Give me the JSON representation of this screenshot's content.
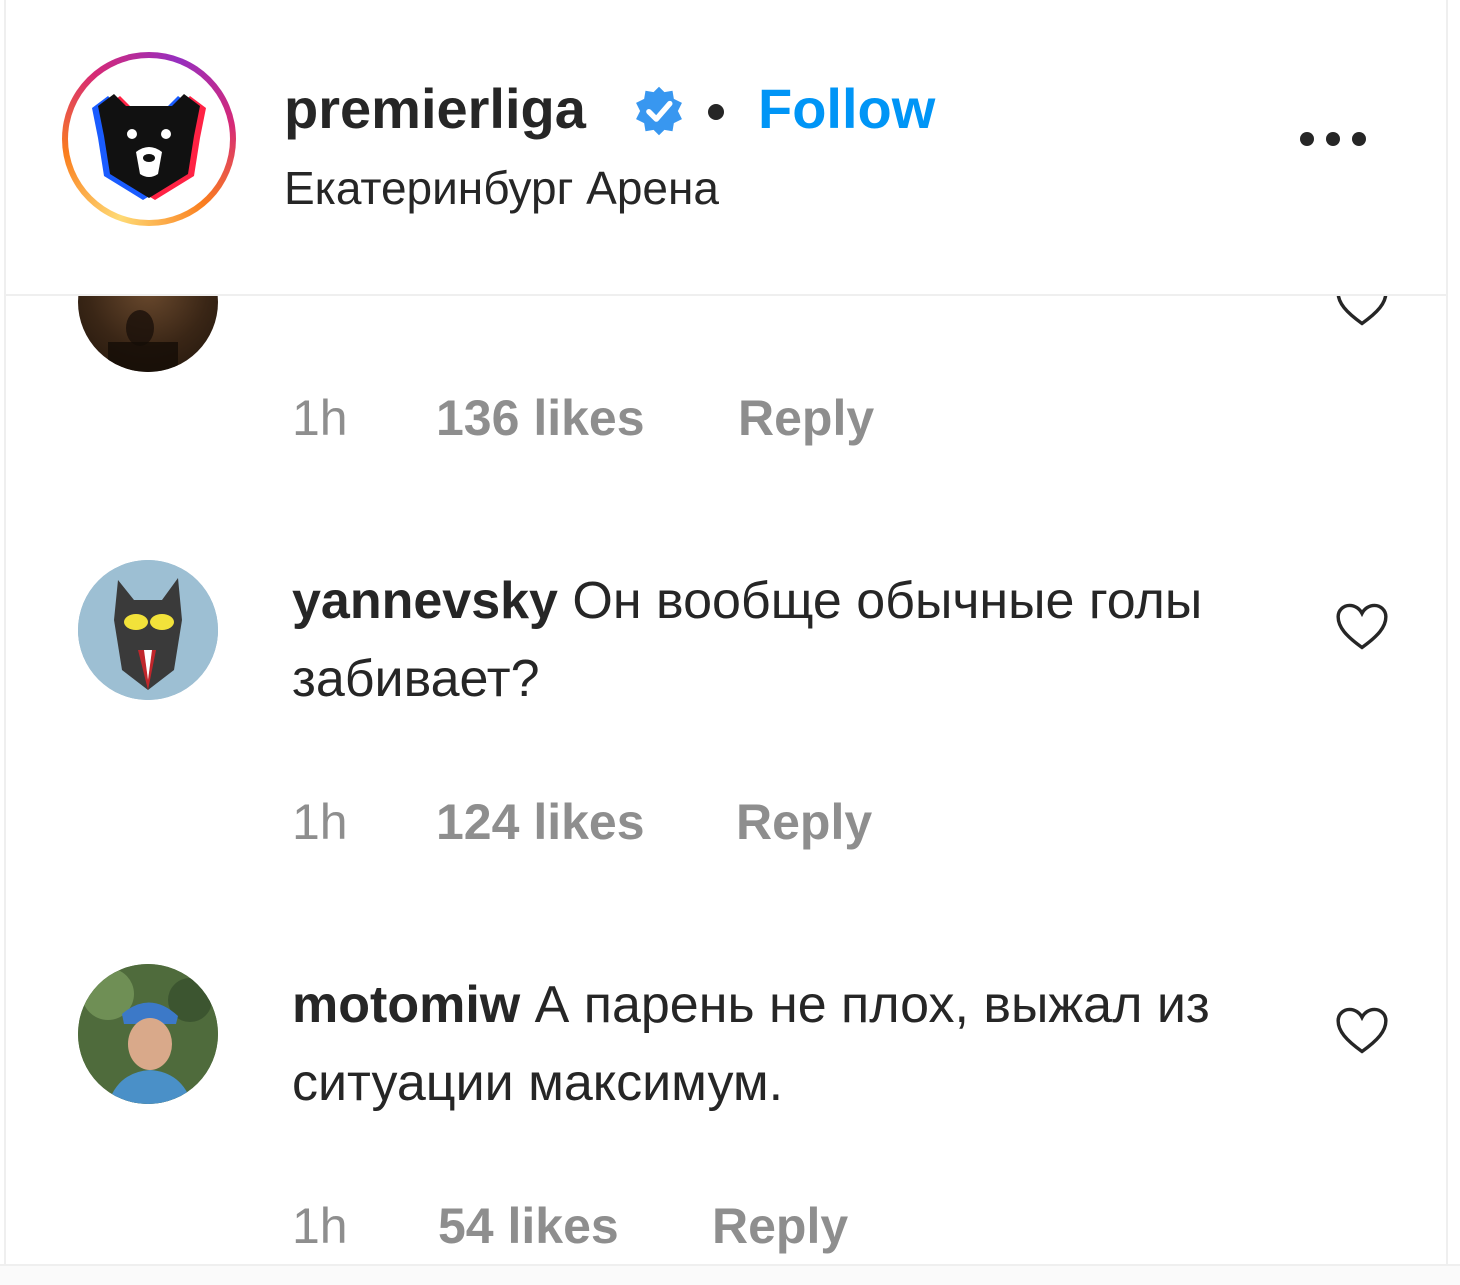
{
  "header": {
    "username": "premierliga",
    "follow_label": "Follow",
    "location": "Екатеринбург Арена"
  },
  "comments": [
    {
      "username": "",
      "text": "",
      "time": "1h",
      "likes": "136 likes",
      "reply_label": "Reply"
    },
    {
      "username": "yannevsky",
      "text": "Он вообще обычные голы забивает?",
      "time": "1h",
      "likes": "124 likes",
      "reply_label": "Reply"
    },
    {
      "username": "motomiw",
      "text": "А парень не плох, выжал из ситуации максимум.",
      "time": "1h",
      "likes": "54 likes",
      "reply_label": "Reply"
    }
  ],
  "colors": {
    "follow": "#0095f6",
    "verified": "#3897f0",
    "meta_text": "#8e8e8e",
    "primary_text": "#262626"
  },
  "icons": [
    "verified-badge-icon",
    "more-options-icon",
    "heart-icon"
  ]
}
